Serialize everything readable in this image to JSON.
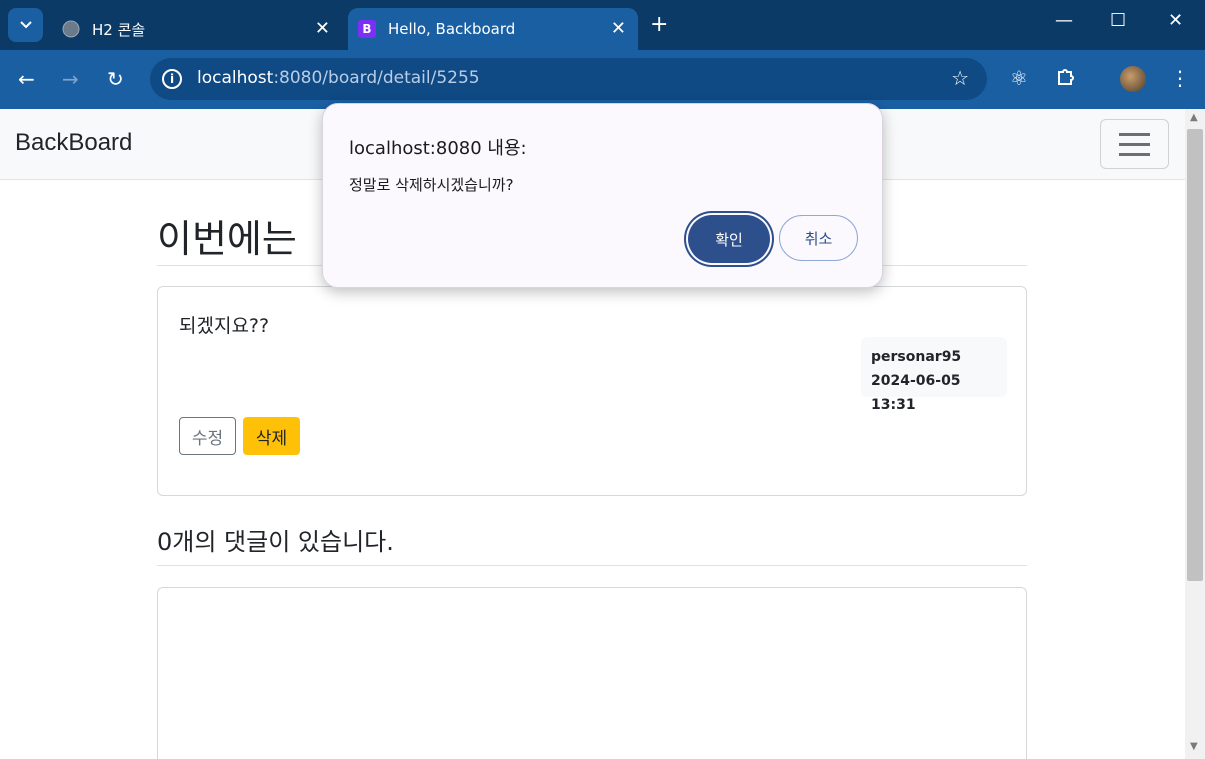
{
  "browser": {
    "tabs": [
      {
        "label": "H2 콘솔",
        "favicon": "globe-icon"
      },
      {
        "label": "Hello, Backboard",
        "favicon": "bootstrap-b-icon",
        "favicon_text": "B"
      }
    ],
    "url_host": "localhost",
    "url_path": ":8080/board/detail/5255"
  },
  "navbar": {
    "brand": "BackBoard"
  },
  "post": {
    "title": "이번에는",
    "content": "되겠지요??",
    "author": "personar95",
    "date": "2024-06-05 13:31",
    "edit_label": "수정",
    "delete_label": "삭제"
  },
  "comments": {
    "heading": "0개의 댓글이 있습니다."
  },
  "dialog": {
    "title": "localhost:8080 내용:",
    "message": "정말로 삭제하시겠습니까?",
    "ok_label": "확인",
    "cancel_label": "취소"
  },
  "colors": {
    "delete_button": "#ffc107",
    "dialog_ok": "#2d4f8c",
    "browser_toolbar": "#1b5fa3"
  }
}
